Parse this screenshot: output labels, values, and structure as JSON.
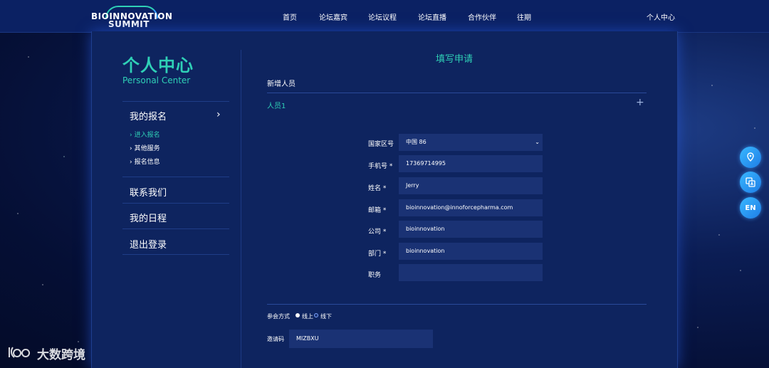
{
  "nav": {
    "logo_line1": "BIOINNOVATION",
    "logo_line2": "SUMMIT",
    "items": [
      "首页",
      "论坛嘉宾",
      "论坛议程",
      "论坛直播",
      "合作伙伴",
      "往期"
    ],
    "user_center": "个人中心"
  },
  "sidebar": {
    "title_cn": "个人中心",
    "title_en": "Personal Center",
    "menu": [
      {
        "label": "我的报名",
        "chevron": "›"
      },
      {
        "label": "联系我们"
      },
      {
        "label": "我的日程"
      },
      {
        "label": "退出登录"
      }
    ],
    "sub_items": [
      {
        "label": "进入报名",
        "active": true
      },
      {
        "label": "其他服务",
        "active": false
      },
      {
        "label": "报名信息",
        "active": false
      }
    ]
  },
  "form": {
    "title": "填写申请",
    "section_title": "新增人员",
    "person_label": "人员1",
    "plus": "+",
    "fields": [
      {
        "label": "国家区号",
        "value": "中国 86",
        "dropdown": true
      },
      {
        "label": "手机号 *",
        "value": "17369714995"
      },
      {
        "label": "姓名 *",
        "value": "Jerry"
      },
      {
        "label": "邮箱 *",
        "value": "bioinnovation@innoforcepharma.com"
      },
      {
        "label": "公司 *",
        "value": "bioinnovation"
      },
      {
        "label": "部门 *",
        "value": "bioinnovation"
      },
      {
        "label": "职务",
        "value": ""
      }
    ],
    "attend": {
      "label": "参会方式",
      "options": [
        {
          "label": "线上",
          "selected": false
        },
        {
          "label": "线下",
          "selected": true
        }
      ]
    },
    "invite": {
      "label": "邀请码",
      "value": "MIZBXU"
    }
  },
  "float_buttons": {
    "map_icon": "map-pin-icon",
    "translate_icon": "translate-icon",
    "lang": "EN"
  },
  "watermark": "大数跨境",
  "colors": {
    "accent": "#2fd0b6",
    "nav_bg": "#0b2163",
    "card_bg": "#0e245f",
    "field_bg": "#1a3274"
  }
}
